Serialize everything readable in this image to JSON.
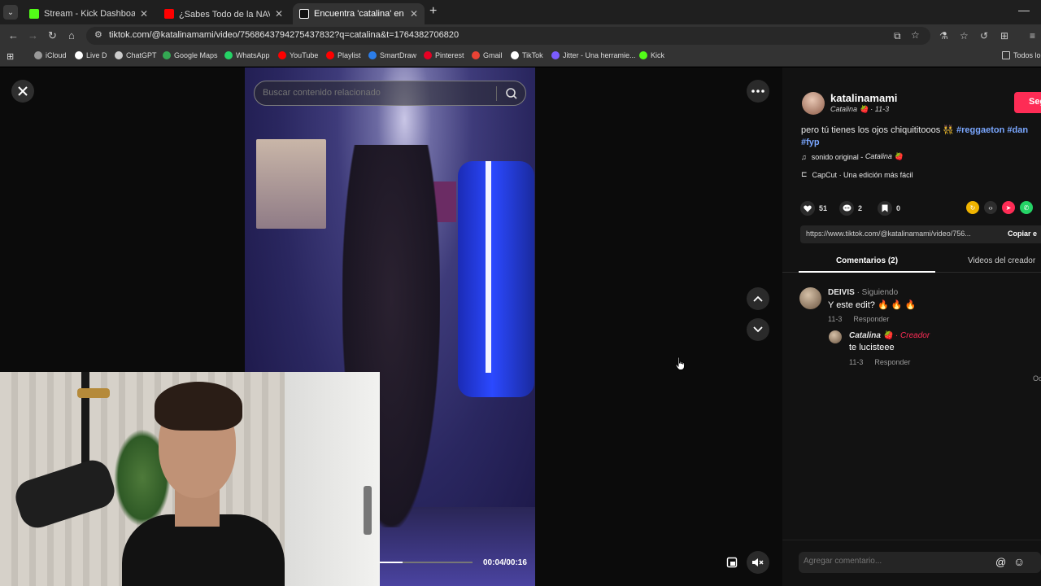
{
  "browser": {
    "tabs": [
      {
        "title": "Stream - Kick Dashboard",
        "color": "#53fc18"
      },
      {
        "title": "¿Sabes Todo de la NAVIDAD? 🎅",
        "color": "#ff0000"
      },
      {
        "title": "Encuentra 'catalina' en TikTok |",
        "color": "#ffffff"
      }
    ],
    "url": "tiktok.com/@katalinamami/video/7568643794275437832?q=catalina&t=1764382706820",
    "bookmarks": [
      {
        "label": "iCloud",
        "color": "#999999"
      },
      {
        "label": "Live D",
        "color": "#ffffff"
      },
      {
        "label": "ChatGPT",
        "color": "#cccccc"
      },
      {
        "label": "Google Maps",
        "color": "#34a853"
      },
      {
        "label": "WhatsApp",
        "color": "#25d366"
      },
      {
        "label": "YouTube",
        "color": "#ff0000"
      },
      {
        "label": "Playlist",
        "color": "#ff0000"
      },
      {
        "label": "SmartDraw",
        "color": "#2b7de9"
      },
      {
        "label": "Pinterest",
        "color": "#e60023"
      },
      {
        "label": "Gmail",
        "color": "#ea4335"
      },
      {
        "label": "TikTok",
        "color": "#ffffff"
      },
      {
        "label": "Jitter - Una herramie...",
        "color": "#7b5cff"
      },
      {
        "label": "Kick",
        "color": "#53fc18"
      }
    ],
    "all_bookmarks": "Todos lo"
  },
  "player": {
    "search_placeholder": "Buscar contenido relacionado",
    "time": "00:04/00:16",
    "progress": 0.25
  },
  "post": {
    "username": "katalinamami",
    "nickname": "Catalina 🍓",
    "date": "11-3",
    "follow": "Seg",
    "caption_text": "pero tú tienes los ojos chiquititooos 👯 ",
    "caption_tag1": "#reggaeton",
    "caption_tag2": "#dan",
    "caption_tag3": "#fyp",
    "music_label": "sonido original - ",
    "music_author": "Catalina 🍓",
    "capcut": "CapCut · Una edición más fácil",
    "likes": "51",
    "comments_count": "2",
    "saves": "0",
    "link": "https://www.tiktok.com/@katalinamami/video/756...",
    "copy_link": "Copiar e",
    "tab_comments": "Comentarios (2)",
    "tab_creator": "Videos del creador"
  },
  "comments": [
    {
      "name": "DEIVIS",
      "badge": " · Siguiendo",
      "text": "Y este edit? 🔥 🔥 🔥",
      "date": "11-3",
      "reply": "Responder"
    },
    {
      "name": "Catalina 🍓",
      "badge": " · Creador",
      "text": "te lucisteee",
      "date": "11-3",
      "reply": "Responder"
    }
  ],
  "more_replies": "Oc",
  "comment_placeholder": "Agregar comentario..."
}
